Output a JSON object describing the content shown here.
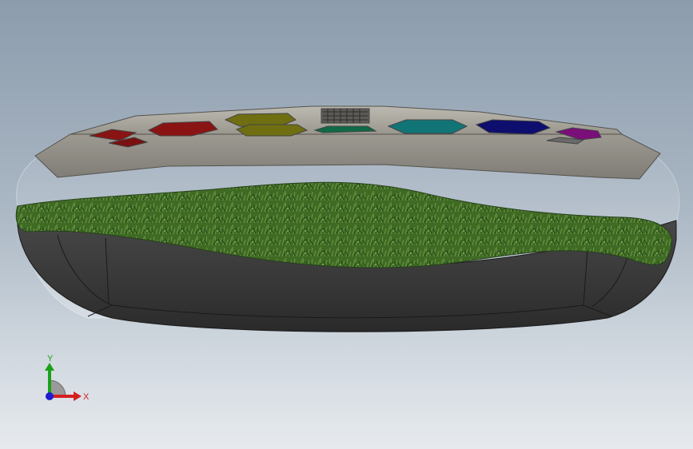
{
  "viewport": {
    "background_top": "#8c9cad",
    "background_bottom": "#e6eaee"
  },
  "model": {
    "top_shell_color": "#8d8b84",
    "pocket_colors": [
      "#8a1414",
      "#6f6f12",
      "#0f6a46",
      "#117577",
      "#0e0e6e",
      "#7a0f7a"
    ],
    "turf_color": "#3f6a24",
    "base_color": "#3a3a3a"
  },
  "triad": {
    "x_label": "X",
    "y_label": "Y",
    "x_color": "#d42020",
    "y_color": "#1aa21a",
    "z_color": "#1c1cd0"
  }
}
